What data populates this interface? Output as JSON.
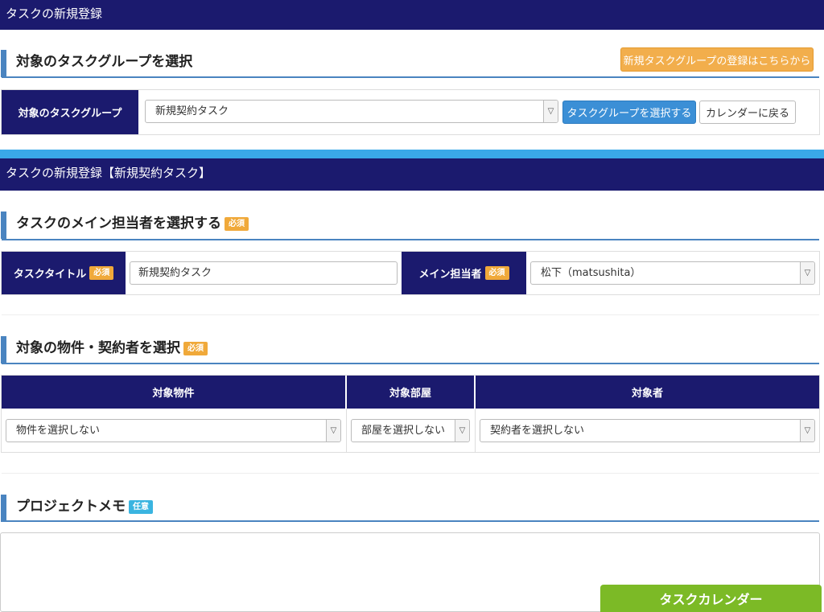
{
  "header": {
    "title": "タスクの新規登録"
  },
  "group_section": {
    "title": "対象のタスクグループを選択",
    "register_link": "新規タスクグループの登録はこちらから",
    "label": "対象のタスクグループ",
    "selected": "新規契約タスク",
    "select_button": "タスクグループを選択する",
    "back_button": "カレンダーに戻る"
  },
  "form_header": {
    "title": "タスクの新規登録【新規契約タスク】"
  },
  "main_section": {
    "title": "タスクのメイン担当者を選択する",
    "badge": "必須",
    "task_title_label": "タスクタイトル",
    "task_title_badge": "必須",
    "task_title_value": "新規契約タスク",
    "assignee_label": "メイン担当者",
    "assignee_badge": "必須",
    "assignee_value": "松下（matsushita）"
  },
  "property_section": {
    "title": "対象の物件・契約者を選択",
    "badge": "必須",
    "columns": [
      "対象物件",
      "対象部屋",
      "対象者"
    ],
    "property_select": "物件を選択しない",
    "room_select": "部屋を選択しない",
    "person_select": "契約者を選択しない"
  },
  "memo_section": {
    "title": "プロジェクトメモ",
    "badge": "任意",
    "value": ""
  },
  "footer": {
    "calendar_button": "タスクカレンダー"
  },
  "colors": {
    "navy": "#1b1a6e",
    "accent_blue": "#3aa8e8",
    "required_badge": "#f0a93a",
    "optional_badge": "#3ab4e0",
    "green_button": "#7cba26"
  }
}
